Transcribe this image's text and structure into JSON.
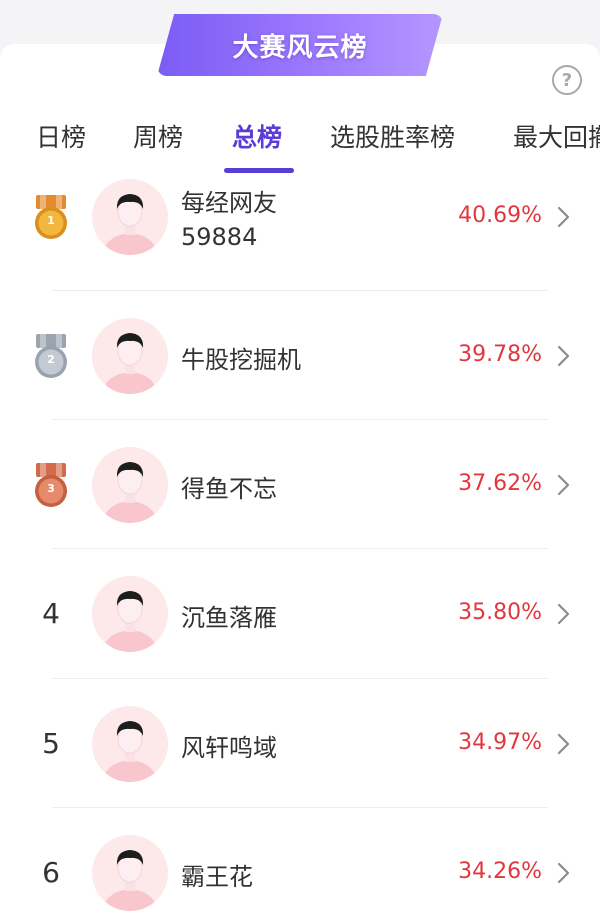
{
  "banner": {
    "title": "大赛风云榜"
  },
  "help": {
    "label": "?"
  },
  "tabs": [
    {
      "label": "日榜",
      "active": false
    },
    {
      "label": "周榜",
      "active": false
    },
    {
      "label": "总榜",
      "active": true
    },
    {
      "label": "选股胜率榜",
      "active": false
    },
    {
      "label": "最大回撤",
      "active": false
    }
  ],
  "rows": [
    {
      "rank": "1",
      "medal": "gold",
      "name": "每经网友",
      "sub": "59884",
      "rate": "40.69%"
    },
    {
      "rank": "2",
      "medal": "silver",
      "name": "牛股挖掘机",
      "sub": "",
      "rate": "39.78%"
    },
    {
      "rank": "3",
      "medal": "bronze",
      "name": "得鱼不忘",
      "sub": "",
      "rate": "37.62%"
    },
    {
      "rank": "4",
      "medal": "",
      "name": "沉鱼落雁",
      "sub": "",
      "rate": "35.80%"
    },
    {
      "rank": "5",
      "medal": "",
      "name": "风轩鸣域",
      "sub": "",
      "rate": "34.97%"
    },
    {
      "rank": "6",
      "medal": "",
      "name": "霸王花",
      "sub": "",
      "rate": "34.26%"
    }
  ],
  "colors": {
    "accent": "#5a3dd6",
    "rate": "#e0383e",
    "avatar_bg": "#fde8ea"
  },
  "icons": {
    "help": "question-circle-icon",
    "chevron": "chevron-right-icon",
    "avatar": "user-avatar-icon"
  }
}
